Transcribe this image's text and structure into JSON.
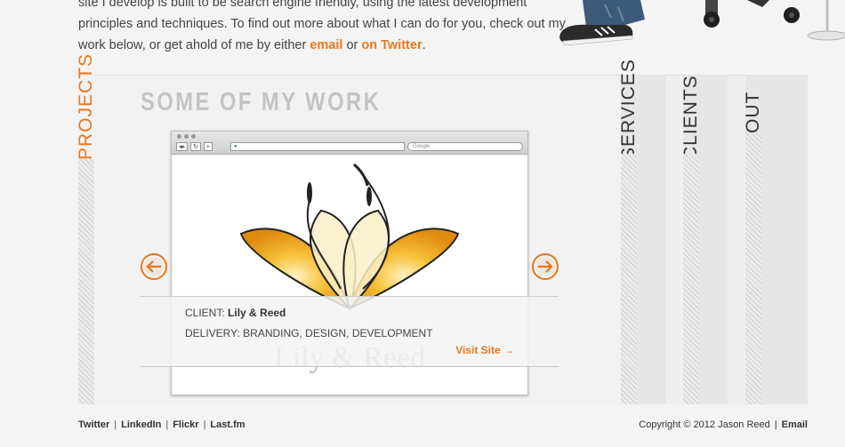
{
  "intro": {
    "line1": "site I develop is built to be search engine friendly, using the latest development",
    "line2": "principles and techniques. To find out more about what I can do for you, check out my",
    "line3_pre": "work below, or get ahold of me by either ",
    "email_link": "email",
    "or_text": " or ",
    "twitter_link": "on Twitter",
    "end": "."
  },
  "tabs": {
    "projects": "PROJECTS",
    "services": "SERVICES",
    "clients": "CLIENTS",
    "about": "ABOUT"
  },
  "work": {
    "title": "SOME OF MY WORK",
    "browser": {
      "search_placeholder": "Google"
    },
    "project": {
      "client_label": "CLIENT:",
      "client_name": "Lily & Reed",
      "delivery_label": "DELIVERY:",
      "delivery_value": "BRANDING, DESIGN, DEVELOPMENT",
      "visit_label": "Visit Site →",
      "logo_text": "Lily & Reed"
    }
  },
  "footer": {
    "links": [
      "Twitter",
      "LinkedIn",
      "Flickr",
      "Last.fm"
    ],
    "copyright": "Copyright © 2012 Jason Reed",
    "email_link": "Email"
  },
  "colors": {
    "accent": "#e8771e",
    "title_gray": "#c3c3c3",
    "text": "#333333"
  }
}
